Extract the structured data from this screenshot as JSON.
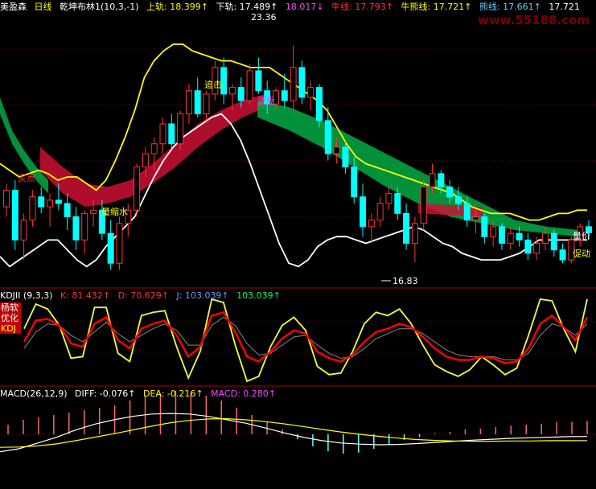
{
  "header": {
    "stock": "美盈森",
    "period": "日线",
    "indicator": "乾坤布林1(10,3,-1)",
    "upper": "上轨: 18.399↑",
    "lower": "下轨: 17.489↑",
    "mid": "18.017↓",
    "bear": "牛线: 17.793↑",
    "bull_bear": "牛熊线: 17.721↑",
    "bear_line": "熊线: 17.661↑",
    "last": "17.721"
  },
  "watermark": "www.55188.com",
  "annotations": {
    "high": "23.36",
    "low": "16.83",
    "chase": "追击",
    "buy_label": "买点",
    "volume_shrink": "量缩水",
    "wash": "洗盘",
    "volume_price": "量价",
    "push": "促动"
  },
  "kdj": {
    "title": "KDJII (9,3,3)",
    "k": "K: 81.432↑",
    "d": "D: 70.629↑",
    "j": "J: 103.039↑",
    "j2": "103.039↑",
    "box": [
      "杨软",
      "优化",
      "KDJ"
    ]
  },
  "macd": {
    "title": "MACD(26,12,9)",
    "diff": "DIFF: -0.076↑",
    "dea": "DEA: -0.216↑",
    "macd": "MACD: 0.280↑"
  },
  "colors": {
    "up": "#ff3333",
    "down": "#00ffff",
    "upper": "#ffff00",
    "lower": "#ffffff",
    "green_band": "#00aa44",
    "red_band": "#cc1133",
    "k": "#ffffff",
    "d": "#ff0000",
    "j": "#6699ff"
  },
  "chart_data": {
    "type": "candlestick",
    "ylim": [
      16.2,
      24.2
    ],
    "candles": [
      [
        18.5,
        19.2,
        18.2,
        19.0
      ],
      [
        19.0,
        19.3,
        17.2,
        17.5
      ],
      [
        17.5,
        18.3,
        16.9,
        18.1
      ],
      [
        18.1,
        19.0,
        17.9,
        18.8
      ],
      [
        18.8,
        19.1,
        18.3,
        18.5
      ],
      [
        18.5,
        18.9,
        17.9,
        18.7
      ],
      [
        18.7,
        19.2,
        18.4,
        18.6
      ],
      [
        18.6,
        18.9,
        17.8,
        18.2
      ],
      [
        18.2,
        18.5,
        17.2,
        17.5
      ],
      [
        17.5,
        18.4,
        17.1,
        18.3
      ],
      [
        18.3,
        18.7,
        17.9,
        18.4
      ],
      [
        18.4,
        18.7,
        17.5,
        17.7
      ],
      [
        17.7,
        18.1,
        16.6,
        16.8
      ],
      [
        16.8,
        18.2,
        16.6,
        18.0
      ],
      [
        18.0,
        18.6,
        17.6,
        18.4
      ],
      [
        18.4,
        19.8,
        18.2,
        19.7
      ],
      [
        19.7,
        20.3,
        19.4,
        20.1
      ],
      [
        20.1,
        20.6,
        19.6,
        20.4
      ],
      [
        20.4,
        21.2,
        20.1,
        21.0
      ],
      [
        21.0,
        21.3,
        20.2,
        20.4
      ],
      [
        20.4,
        21.4,
        20.2,
        21.3
      ],
      [
        21.3,
        22.2,
        21.0,
        22.0
      ],
      [
        22.0,
        22.4,
        21.2,
        21.3
      ],
      [
        21.3,
        22.0,
        21.1,
        21.9
      ],
      [
        21.9,
        22.9,
        21.7,
        22.7
      ],
      [
        22.7,
        23.0,
        21.6,
        21.9
      ],
      [
        21.9,
        22.2,
        21.4,
        22.1
      ],
      [
        22.1,
        22.4,
        21.5,
        21.7
      ],
      [
        21.7,
        22.8,
        21.6,
        22.6
      ],
      [
        22.6,
        23.0,
        21.9,
        22.0
      ],
      [
        22.0,
        22.3,
        21.3,
        21.6
      ],
      [
        21.6,
        22.1,
        21.4,
        22.0
      ],
      [
        22.0,
        22.5,
        21.5,
        21.7
      ],
      [
        21.7,
        23.36,
        21.3,
        22.7
      ],
      [
        22.7,
        22.9,
        21.6,
        21.8
      ],
      [
        21.8,
        22.3,
        21.4,
        22.1
      ],
      [
        22.1,
        22.2,
        20.9,
        21.1
      ],
      [
        21.1,
        21.5,
        19.9,
        20.1
      ],
      [
        20.1,
        20.6,
        19.8,
        20.3
      ],
      [
        20.3,
        20.5,
        19.5,
        19.7
      ],
      [
        19.7,
        20.0,
        18.6,
        18.8
      ],
      [
        18.8,
        19.2,
        17.6,
        17.9
      ],
      [
        17.9,
        18.3,
        17.4,
        18.1
      ],
      [
        18.1,
        18.8,
        17.9,
        18.6
      ],
      [
        18.6,
        19.1,
        18.4,
        18.9
      ],
      [
        18.9,
        19.1,
        18.1,
        18.3
      ],
      [
        18.3,
        18.6,
        17.2,
        17.4
      ],
      [
        17.4,
        18.2,
        16.83,
        18.0
      ],
      [
        18.0,
        19.3,
        17.8,
        19.1
      ],
      [
        19.1,
        19.8,
        18.9,
        19.5
      ],
      [
        19.5,
        19.6,
        18.9,
        19.1
      ],
      [
        19.1,
        19.3,
        18.6,
        18.8
      ],
      [
        18.8,
        19.1,
        18.4,
        18.6
      ],
      [
        18.6,
        18.8,
        17.9,
        18.1
      ],
      [
        18.1,
        18.4,
        17.7,
        18.2
      ],
      [
        18.2,
        18.3,
        17.4,
        17.6
      ],
      [
        17.6,
        18.1,
        17.3,
        17.9
      ],
      [
        17.9,
        18.0,
        17.2,
        17.4
      ],
      [
        17.4,
        17.9,
        17.2,
        17.7
      ],
      [
        17.7,
        17.9,
        17.3,
        17.5
      ],
      [
        17.5,
        17.7,
        16.9,
        17.1
      ],
      [
        17.1,
        17.6,
        16.9,
        17.4
      ],
      [
        17.4,
        17.9,
        17.2,
        17.7
      ],
      [
        17.7,
        17.8,
        17.0,
        17.2
      ],
      [
        17.2,
        17.4,
        16.8,
        16.9
      ],
      [
        16.9,
        17.6,
        16.8,
        17.5
      ],
      [
        17.5,
        18.0,
        17.3,
        17.9
      ],
      [
        17.9,
        18.1,
        17.5,
        17.72
      ]
    ],
    "upper": [
      19.8,
      19.6,
      19.4,
      19.5,
      19.6,
      19.5,
      19.3,
      19.4,
      19.4,
      19.2,
      19.0,
      19.3,
      19.9,
      20.6,
      21.4,
      22.4,
      22.9,
      23.2,
      23.4,
      23.4,
      23.2,
      23.1,
      23.0,
      22.9,
      22.9,
      22.8,
      22.7,
      22.7,
      22.7,
      22.5,
      22.3,
      22.1,
      21.9,
      21.7,
      21.4,
      20.9,
      20.4,
      20.0,
      19.8,
      19.7,
      19.6,
      19.5,
      19.4,
      19.3,
      19.2,
      19.1,
      19.0,
      18.9,
      18.7,
      18.5,
      18.4,
      18.3,
      18.3,
      18.3,
      18.2,
      18.1,
      18.1,
      18.2,
      18.3,
      18.3,
      18.4,
      18.4
    ],
    "lower": [
      17.0,
      16.7,
      16.9,
      17.1,
      17.3,
      17.5,
      17.5,
      17.2,
      16.9,
      16.7,
      16.9,
      17.3,
      17.6,
      17.9,
      18.2,
      18.8,
      19.4,
      19.9,
      20.3,
      20.6,
      20.8,
      21.0,
      21.2,
      21.3,
      21.0,
      20.5,
      19.8,
      19.0,
      18.2,
      17.4,
      16.8,
      16.7,
      16.9,
      17.3,
      17.5,
      17.6,
      17.6,
      17.5,
      17.4,
      17.5,
      17.6,
      17.7,
      17.8,
      17.9,
      17.8,
      17.6,
      17.4,
      17.3,
      17.1,
      17.0,
      16.9,
      16.9,
      16.9,
      17.0,
      17.1,
      17.3,
      17.5,
      17.5,
      17.5,
      17.5,
      17.5,
      17.5
    ],
    "green_band": [
      [
        21.8,
        21.3
      ],
      [
        20.8,
        20.4
      ],
      [
        20.2,
        19.8
      ],
      [
        19.7,
        19.3
      ],
      [
        19.3,
        18.9
      ],
      [
        21.7,
        21.2
      ],
      [
        21.5,
        20.8
      ],
      [
        21.1,
        20.3
      ],
      [
        20.6,
        19.7
      ],
      [
        20.1,
        19.1
      ],
      [
        19.6,
        18.6
      ],
      [
        19.1,
        18.2
      ],
      [
        18.6,
        18.0
      ],
      [
        18.1,
        17.8
      ],
      [
        17.9,
        17.7
      ],
      [
        17.8,
        17.6
      ]
    ],
    "red_band": [
      [
        20.3,
        19.6
      ],
      [
        19.7,
        18.9
      ],
      [
        19.2,
        18.5
      ],
      [
        19.1,
        18.6
      ],
      [
        19.3,
        18.8
      ],
      [
        19.8,
        19.2
      ],
      [
        20.4,
        19.7
      ],
      [
        21.0,
        20.3
      ],
      [
        21.4,
        20.8
      ],
      [
        21.7,
        21.2
      ],
      [
        21.9,
        21.5
      ],
      [
        18.6,
        18.3
      ],
      [
        18.5,
        18.2
      ]
    ],
    "kdj_k": [
      48,
      74,
      76,
      68,
      46,
      42,
      70,
      78,
      50,
      40,
      64,
      70,
      74,
      56,
      30,
      42,
      80,
      84,
      60,
      30,
      24,
      36,
      52,
      62,
      58,
      36,
      28,
      24,
      32,
      48,
      60,
      64,
      70,
      66,
      54,
      40,
      30,
      26,
      26,
      30,
      28,
      22,
      24,
      40,
      70,
      80,
      66,
      50,
      78
    ],
    "kdj_d": [
      40,
      60,
      70,
      68,
      56,
      48,
      60,
      72,
      58,
      48,
      56,
      64,
      70,
      62,
      44,
      44,
      68,
      78,
      68,
      46,
      32,
      34,
      44,
      54,
      56,
      44,
      34,
      28,
      30,
      40,
      52,
      58,
      64,
      64,
      58,
      48,
      38,
      32,
      30,
      30,
      30,
      26,
      26,
      34,
      56,
      70,
      66,
      56,
      70
    ],
    "kdj_j": [
      64,
      94,
      88,
      68,
      28,
      30,
      90,
      90,
      34,
      24,
      80,
      84,
      86,
      42,
      4,
      36,
      100,
      96,
      44,
      0,
      6,
      42,
      68,
      78,
      62,
      18,
      8,
      10,
      36,
      70,
      84,
      80,
      88,
      70,
      44,
      20,
      12,
      6,
      14,
      30,
      20,
      8,
      16,
      56,
      100,
      98,
      64,
      36,
      100
    ],
    "macd_hist": [
      0.2,
      0.3,
      0.35,
      0.4,
      0.45,
      0.5,
      0.55,
      0.6,
      0.7,
      0.8,
      0.85,
      0.9,
      0.85,
      0.8,
      0.7,
      0.55,
      0.4,
      0.25,
      0.1,
      -0.1,
      -0.25,
      -0.35,
      -0.4,
      -0.38,
      -0.3,
      -0.2,
      -0.12,
      -0.05,
      0.02,
      0.05,
      0.1,
      0.12,
      0.15,
      0.18,
      0.2,
      0.22,
      0.25,
      0.26,
      0.28
    ],
    "macd_diff": [
      -0.6,
      -0.5,
      -0.3,
      -0.1,
      0.15,
      0.35,
      0.5,
      0.62,
      0.7,
      0.72,
      0.7,
      0.62,
      0.5,
      0.38,
      0.22,
      0.05,
      -0.1,
      -0.22,
      -0.3,
      -0.34,
      -0.36,
      -0.35,
      -0.32,
      -0.28,
      -0.24,
      -0.2,
      -0.17,
      -0.14,
      -0.12,
      -0.1,
      -0.08,
      -0.076
    ],
    "macd_dea": [
      -0.45,
      -0.44,
      -0.4,
      -0.33,
      -0.22,
      -0.1,
      0.02,
      0.15,
      0.28,
      0.4,
      0.48,
      0.53,
      0.54,
      0.5,
      0.44,
      0.36,
      0.27,
      0.17,
      0.08,
      0.0,
      -0.07,
      -0.13,
      -0.18,
      -0.21,
      -0.23,
      -0.24,
      -0.24,
      -0.23,
      -0.23,
      -0.22,
      -0.22,
      -0.216
    ]
  }
}
